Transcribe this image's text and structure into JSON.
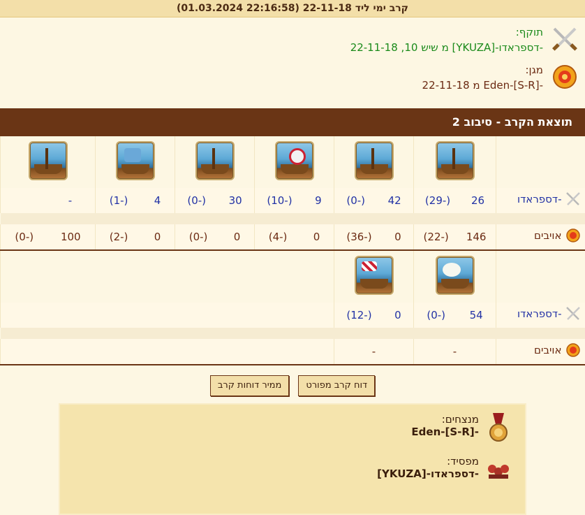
{
  "title": "קרב ימי ליד 22-11-18 (22:16:58 01.03.2024)",
  "attacker": {
    "label": "תוקף:",
    "text": "-דספראדו-[YKUZA] מ שיש 10, 22-11-18"
  },
  "defender": {
    "label": "מגן:",
    "text": "-Eden-[S-R] מ 22-11-18"
  },
  "result_header": "תוצאת הקרב - סיבוב 2",
  "own_label": "-דספראדו",
  "enemy_label": "אויבים",
  "block1": {
    "own": [
      {
        "count": "26",
        "loss": "(-29)"
      },
      {
        "count": "42",
        "loss": "(-0)"
      },
      {
        "count": "9",
        "loss": "(-10)"
      },
      {
        "count": "30",
        "loss": "(-0)"
      },
      {
        "count": "4",
        "loss": "(-1)"
      },
      {
        "count": "-",
        "loss": ""
      }
    ],
    "enemy": [
      {
        "count": "146",
        "loss": "(-22)"
      },
      {
        "count": "0",
        "loss": "(-36)"
      },
      {
        "count": "0",
        "loss": "(-4)"
      },
      {
        "count": "0",
        "loss": "(-0)"
      },
      {
        "count": "0",
        "loss": "(-2)"
      },
      {
        "count": "100",
        "loss": "(-0)"
      }
    ]
  },
  "block2": {
    "own": [
      {
        "count": "54",
        "loss": "(-0)"
      },
      {
        "count": "0",
        "loss": "(-12)"
      }
    ],
    "enemy": [
      {
        "count": "-",
        "loss": ""
      },
      {
        "count": "-",
        "loss": ""
      }
    ]
  },
  "buttons": {
    "detailed": "דוח קרב מפורט",
    "converter": "ממיר דוחות קרב"
  },
  "summary": {
    "winners_label": "מנצחים:",
    "winners_value": "-Eden-[S-R]",
    "loser_label": "מפסיד:",
    "loser_value": "-דספראדו-[YKUZA]"
  },
  "colors": {
    "header_brown": "#6a3515",
    "attacker_green": "#1a8a1a",
    "own_blue": "#2232a5"
  }
}
